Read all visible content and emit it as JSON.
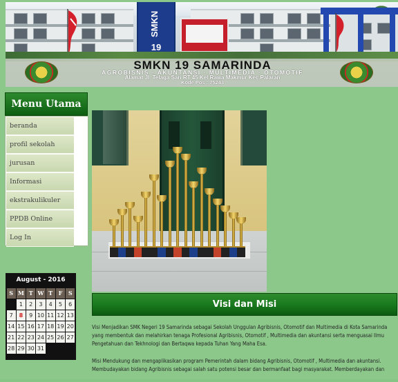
{
  "header": {
    "tower_text": "SMKN",
    "tower_number": "19",
    "school_name": "SMKN 19 SAMARINDA",
    "programs": "AGROBISNIS · AKUNTANSI · MULTIMEDIA · OTOMOTIF",
    "address": "Alamat Jl. Telaga Sari RT 45 Kel.Rawa Makmur Kec.Palaran",
    "postcode": "Kode Pos : 75243",
    "colors": {
      "menu_green": "#1a7a1e",
      "page_bg": "#8bc88a"
    }
  },
  "menu": {
    "title": "Menu Utama",
    "items": [
      {
        "label": "beranda"
      },
      {
        "label": "profil sekolah"
      },
      {
        "label": "jurusan"
      },
      {
        "label": "Informasi"
      },
      {
        "label": "ekstrakulikuler"
      },
      {
        "label": "PPDB Online"
      },
      {
        "label": "Log In"
      }
    ]
  },
  "calendar": {
    "title": "August - 2016",
    "day_headers": [
      "S",
      "M",
      "T",
      "W",
      "T",
      "F",
      "S"
    ],
    "weeks": [
      [
        "",
        "1",
        "2",
        "3",
        "4",
        "5",
        "6"
      ],
      [
        "7",
        "8",
        "9",
        "10",
        "11",
        "12",
        "13"
      ],
      [
        "14",
        "15",
        "16",
        "17",
        "18",
        "19",
        "20"
      ],
      [
        "21",
        "22",
        "23",
        "24",
        "25",
        "26",
        "27"
      ],
      [
        "28",
        "29",
        "30",
        "31",
        "",
        "",
        ""
      ]
    ],
    "today": "8"
  },
  "main": {
    "section_title": "Visi dan Misi",
    "paragraphs": [
      "Visi Menjadikan SMK Negeri 19 Samarinda sebagai Sekolah Unggulan Agribisnis, Otomotif dan Multimedia di Kota Samarinda yang membentuk dan melahirkan tenaga Profesional Agribisnis, Otomotif , Multimedia dan akuntansi serta menguasai Ilmu Pengetahuan dan Tekhnologi dan Bertaqwa kepada Tuhan Yang Maha Esa.",
      "Misi Mendukung dan mengaplikasikan program Pemerintah dalam bidang Agribisnis, Otomotif , Multimedia dan akuntansi. Membudayakan bidang Agribisnis sebagai salah satu potensi besar dan bermanfaat bagi masyarakat. Memberdayakan dan"
    ]
  }
}
